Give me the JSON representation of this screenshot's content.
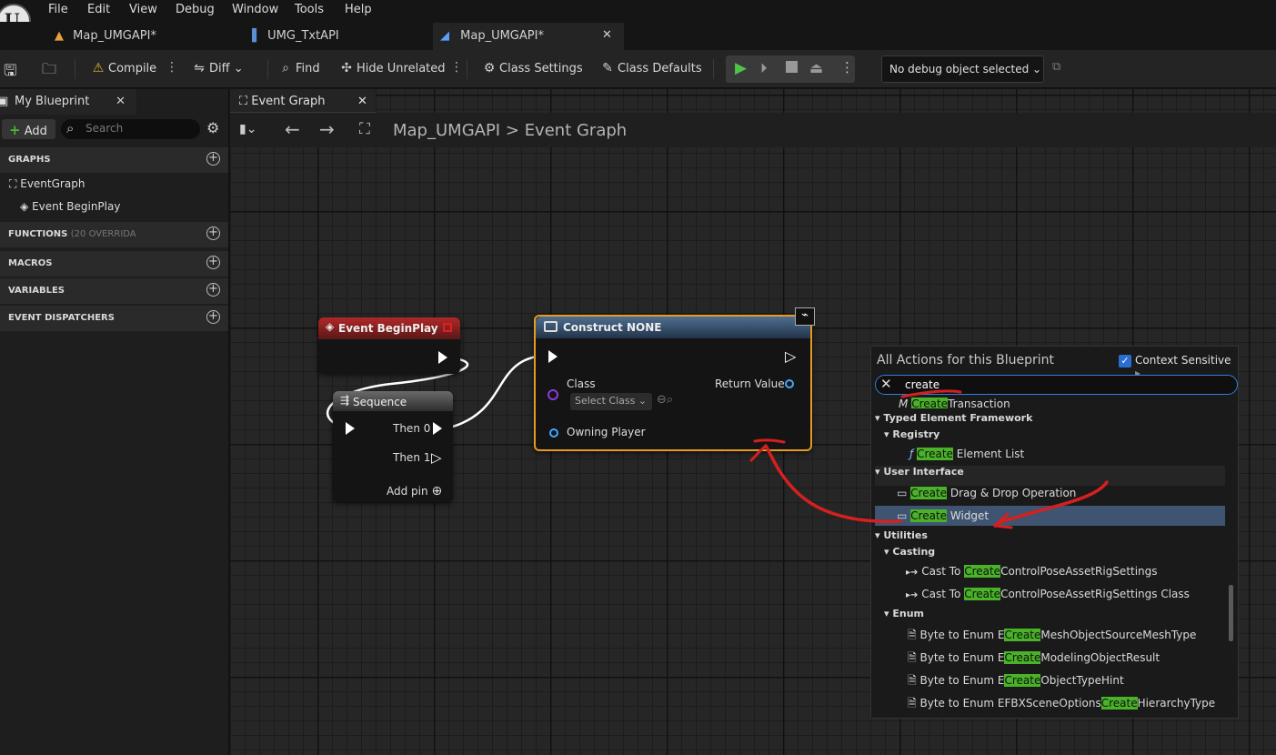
{
  "menu": [
    "File",
    "Edit",
    "View",
    "Debug",
    "Window",
    "Tools",
    "Help"
  ],
  "tabs": [
    {
      "label": "Map_UMGAPI*"
    },
    {
      "label": "UMG_TxtAPI"
    },
    {
      "label": "Map_UMGAPI*"
    }
  ],
  "toolbar": {
    "compile": "Compile",
    "diff": "Diff",
    "find": "Find",
    "hide_unrelated": "Hide Unrelated",
    "class_settings": "Class Settings",
    "class_defaults": "Class Defaults",
    "debug_select": "No debug object selected"
  },
  "left": {
    "tab": "My Blueprint",
    "add": "Add",
    "search_placeholder": "Search",
    "graphs": "GRAPHS",
    "event_graph": "EventGraph",
    "event_beginplay": "Event BeginPlay",
    "functions": "FUNCTIONS",
    "functions_count": "(20 OVERRIDA",
    "macros": "MACROS",
    "variables": "VARIABLES",
    "dispatchers": "EVENT DISPATCHERS"
  },
  "graph": {
    "tab": "Event Graph",
    "breadcrumb_a": "Map_UMGAPI",
    "breadcrumb_sep": ">",
    "breadcrumb_b": "Event Graph"
  },
  "nodes": {
    "beginplay": {
      "title": "Event BeginPlay"
    },
    "sequence": {
      "title": "Sequence",
      "then0": "Then 0",
      "then1": "Then 1",
      "addpin": "Add pin"
    },
    "construct": {
      "title": "Construct NONE",
      "class": "Class",
      "select_class": "Select Class",
      "return_value": "Return Value",
      "owning_player": "Owning Player"
    }
  },
  "popup": {
    "title": "All Actions for this Blueprint",
    "context": "Context Sensitive",
    "query": "create",
    "rows": {
      "r0": {
        "hl": "Create",
        "rest": "Transaction"
      },
      "typed": "Typed Element Framework",
      "registry": "Registry",
      "r1": {
        "hl": "Create",
        "rest": "Element List"
      },
      "ui": "User Interface",
      "r2": {
        "hl": "Create",
        "rest": "Drag & Drop Operation"
      },
      "r3": {
        "hl": "Create",
        "rest": "Widget"
      },
      "utilities": "Utilities",
      "casting": "Casting",
      "r4": {
        "pre": "Cast To ",
        "hl": "Create",
        "rest": "ControlPoseAssetRigSettings"
      },
      "r5": {
        "pre": "Cast To ",
        "hl": "Create",
        "rest": "ControlPoseAssetRigSettings Class"
      },
      "enum": "Enum",
      "r6": {
        "pre": "Byte to Enum E",
        "hl": "Create",
        "rest": "MeshObjectSourceMeshType"
      },
      "r7": {
        "pre": "Byte to Enum E",
        "hl": "Create",
        "rest": "ModelingObjectResult"
      },
      "r8": {
        "pre": "Byte to Enum E",
        "hl": "Create",
        "rest": "ObjectTypeHint"
      },
      "r9": {
        "pre": "Byte to Enum EFBXSceneOptions",
        "hl": "Create",
        "rest": "HierarchyType"
      }
    }
  },
  "colors": {
    "accent_blue": "#2f7fe0",
    "highlight_green": "#49b228",
    "annotation_red": "#d42020",
    "construct_border": "#e69a1e"
  }
}
